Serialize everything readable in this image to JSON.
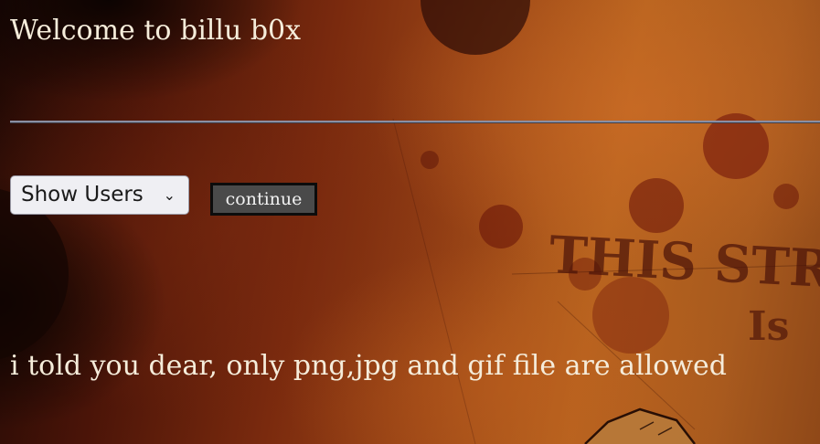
{
  "header": {
    "title": "Welcome to billu b0x"
  },
  "form": {
    "select_value": "Show Users",
    "continue_label": "continue"
  },
  "status": {
    "message": "i told you dear, only png,jpg and gif file are allowed"
  },
  "background": {
    "decor_text_line1": "THIS STRA",
    "decor_text_line2": "Is",
    "colors": {
      "dark": "#1e0804",
      "mid": "#7a2a0e",
      "light": "#b8641f"
    }
  }
}
